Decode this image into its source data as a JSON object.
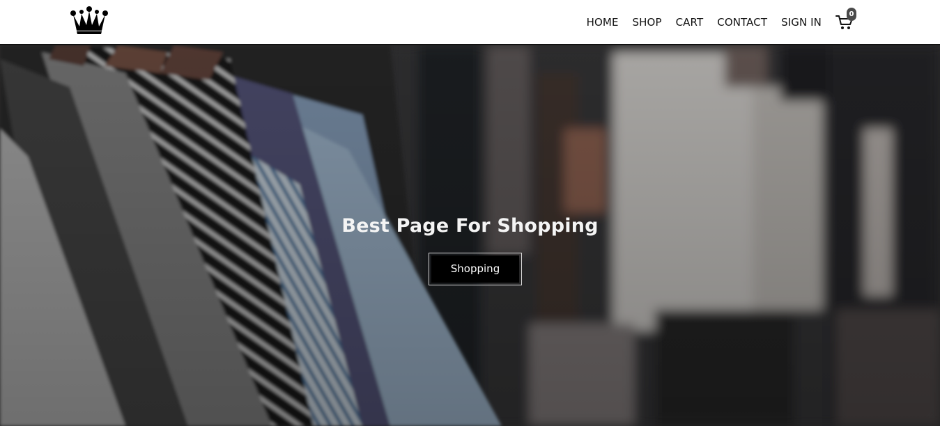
{
  "brand": {
    "logo_icon": "crown-icon"
  },
  "nav": {
    "items": [
      {
        "label": "HOME"
      },
      {
        "label": "SHOP"
      },
      {
        "label": "CART"
      },
      {
        "label": "CONTACT"
      },
      {
        "label": "SIGN IN"
      }
    ],
    "cart_icon": "cart-icon",
    "cart_count": "0"
  },
  "hero": {
    "title": "Best Page For Shopping",
    "button_label": "Shopping"
  },
  "colors": {
    "accent": "#000000",
    "nav_bg": "#ffffff",
    "hero_overlay": "#2e2d2d"
  }
}
